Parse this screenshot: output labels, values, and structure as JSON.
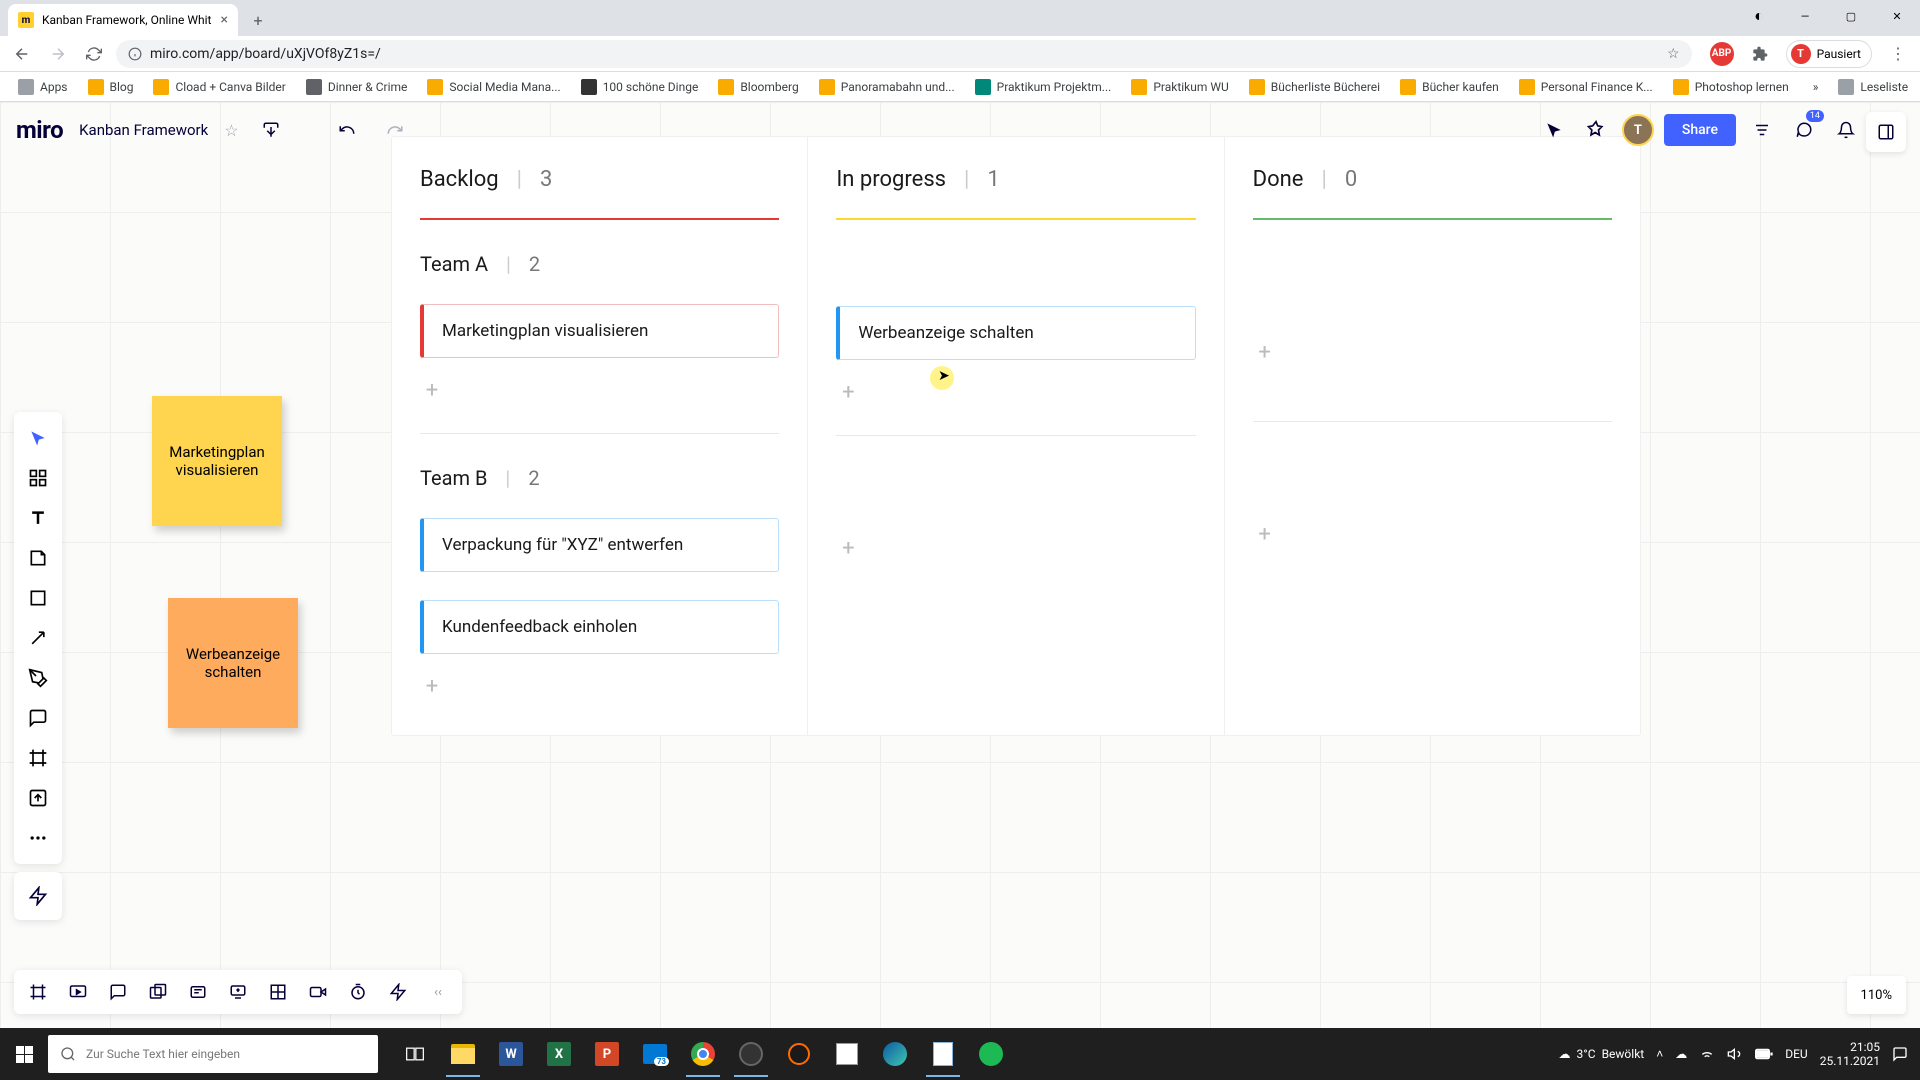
{
  "browser": {
    "tab_title": "Kanban Framework, Online Whit",
    "url": "miro.com/app/board/uXjVOf8yZ1s=/",
    "profile_label": "Pausiert",
    "bookmarks": [
      "Apps",
      "Blog",
      "Cload + Canva Bilder",
      "Dinner & Crime",
      "Social Media Mana...",
      "100 schöne Dinge",
      "Bloomberg",
      "Panoramabahn und...",
      "Praktikum Projektm...",
      "Praktikum WU",
      "Bücherliste Bücherei",
      "Bücher kaufen",
      "Personal Finance K...",
      "Photoshop lernen"
    ],
    "bookmarks_overflow": "»",
    "bookmarks_right": "Leseliste"
  },
  "miro": {
    "logo": "miro",
    "board_name": "Kanban Framework",
    "share": "Share",
    "notif_badge": "14",
    "zoom": "110%"
  },
  "stickies": {
    "yellow": "Marketingplan visualisieren",
    "orange": "Werbeanzeige schalten"
  },
  "kanban": {
    "columns": [
      {
        "title": "Backlog",
        "count": "3"
      },
      {
        "title": "In progress",
        "count": "1"
      },
      {
        "title": "Done",
        "count": "0"
      }
    ],
    "lanes": [
      {
        "title": "Team A",
        "count": "2"
      },
      {
        "title": "Team B",
        "count": "2"
      }
    ],
    "cards": {
      "backlog_a": {
        "text": "Marketingplan visualisieren"
      },
      "inprog_a": {
        "text": "Werbeanzeige schalten"
      },
      "backlog_b1": {
        "text": "Verpackung für \"XYZ\" entwerfen"
      },
      "backlog_b2": {
        "text": "Kundenfeedback einholen"
      }
    }
  },
  "taskbar": {
    "search_placeholder": "Zur Suche Text hier eingeben",
    "weather_temp": "3°C",
    "weather_desc": "Bewölkt",
    "lang": "DEU",
    "time": "21:05",
    "date": "25.11.2021"
  }
}
